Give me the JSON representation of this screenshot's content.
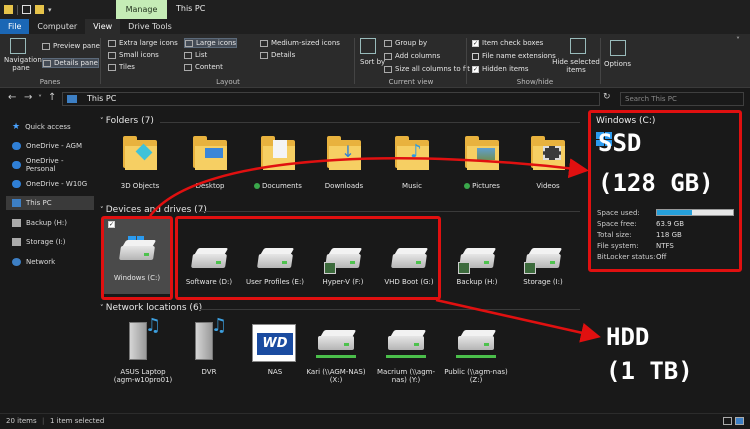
{
  "window": {
    "title": "This PC",
    "context_tab": "Manage"
  },
  "tabs": [
    "File",
    "Computer",
    "View",
    "Drive Tools"
  ],
  "ribbon": {
    "panes": {
      "navigation_pane": "Navigation pane",
      "preview_pane": "Preview pane",
      "details_pane": "Details pane",
      "label": "Panes"
    },
    "layout": {
      "items": [
        "Extra large icons",
        "Large icons",
        "Medium-sized icons",
        "Small icons",
        "List",
        "Details",
        "Tiles",
        "Content"
      ],
      "label": "Layout"
    },
    "current_view": {
      "sort_by": "Sort by",
      "group_by": "Group by",
      "add_columns": "Add columns",
      "size_all": "Size all columns to fit",
      "label": "Current view"
    },
    "show_hide": {
      "item_check_boxes": "Item check boxes",
      "file_name_extensions": "File name extensions",
      "hidden_items": "Hidden items",
      "hide_selected": "Hide selected items",
      "label": "Show/hide"
    },
    "options": "Options"
  },
  "address": {
    "path": "This PC",
    "search_placeholder": "Search This PC"
  },
  "sidebar": {
    "items": [
      {
        "label": "Quick access",
        "icon": "star-icon"
      },
      {
        "label": "OneDrive - AGM",
        "icon": "cloud-icon"
      },
      {
        "label": "OneDrive - Personal",
        "icon": "cloud-icon"
      },
      {
        "label": "OneDrive - W10G",
        "icon": "cloud-icon"
      },
      {
        "label": "This PC",
        "icon": "pc-icon"
      },
      {
        "label": "Backup (H:)",
        "icon": "drive-icon"
      },
      {
        "label": "Storage (I:)",
        "icon": "drive-icon"
      },
      {
        "label": "Network",
        "icon": "network-icon"
      }
    ]
  },
  "sections": {
    "folders": "Folders (7)",
    "devices": "Devices and drives (7)",
    "network": "Network locations (6)"
  },
  "folders": [
    "3D Objects",
    "Desktop",
    "Documents",
    "Downloads",
    "Music",
    "Pictures",
    "Videos"
  ],
  "drives": [
    "Windows (C:)",
    "Software (D:)",
    "User Profiles (E:)",
    "Hyper-V (F:)",
    "VHD Boot (G:)",
    "Backup (H:)",
    "Storage (I:)"
  ],
  "network": [
    {
      "name": "ASUS Laptop (agm-w10pro01)"
    },
    {
      "name": "DVR"
    },
    {
      "name": "NAS",
      "logo": "WD"
    },
    {
      "name": "Kari (\\\\AGM-NAS) (X:)"
    },
    {
      "name": "Macrium (\\\\agm-nas) (Y:)"
    },
    {
      "name": "Public (\\\\agm-nas) (Z:)"
    }
  ],
  "details": {
    "title": "Windows (C:)",
    "rows": [
      {
        "label": "Space used:",
        "value": ""
      },
      {
        "label": "Space free:",
        "value": "63.9 GB"
      },
      {
        "label": "Total size:",
        "value": "118 GB"
      },
      {
        "label": "File system:",
        "value": "NTFS"
      },
      {
        "label": "BitLocker status:",
        "value": "Off"
      }
    ],
    "used_fraction": 0.46
  },
  "annotations": {
    "ssd": "SSD",
    "ssd_size": "(128 GB)",
    "hdd": "HDD",
    "hdd_size": "(1 TB)"
  },
  "status": {
    "items": "20 items",
    "selected": "1 item selected"
  },
  "colors": {
    "accent": "#1b67b5",
    "highlight": "#e01010",
    "manage": "#c5ecb6"
  }
}
